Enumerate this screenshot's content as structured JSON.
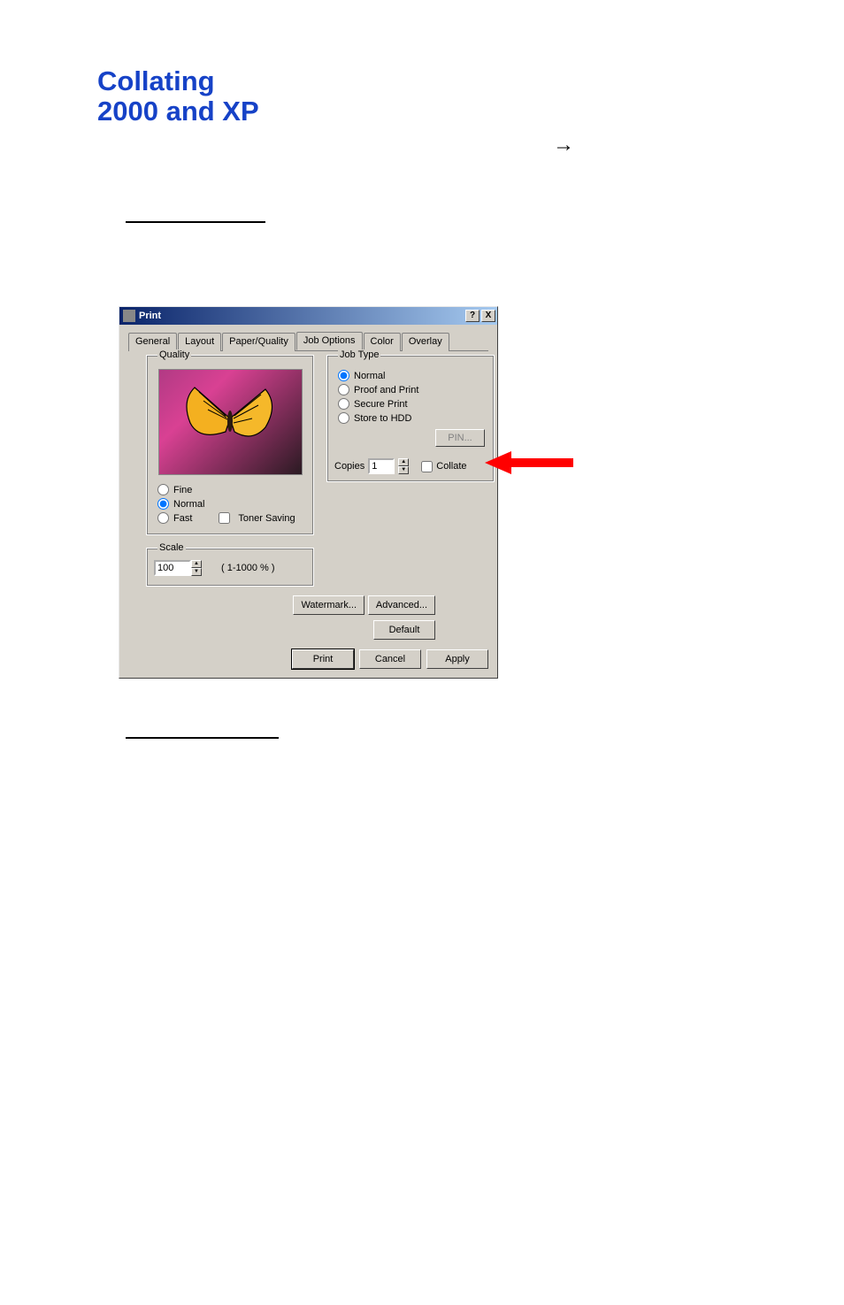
{
  "page": {
    "title_line1": "Collating",
    "title_line2": "2000 and XP"
  },
  "dialog": {
    "title": "Print",
    "help_btn": "?",
    "close_btn": "X",
    "tabs": [
      "General",
      "Layout",
      "Paper/Quality",
      "Job Options",
      "Color",
      "Overlay"
    ],
    "active_tab_index": 3,
    "quality": {
      "legend": "Quality",
      "options": [
        "Fine",
        "Normal",
        "Fast"
      ],
      "selected": "Normal",
      "toner_saving": "Toner Saving",
      "toner_saving_checked": false
    },
    "scale": {
      "legend": "Scale",
      "value": "100",
      "range": "( 1-1000 % )"
    },
    "job_type": {
      "legend": "Job Type",
      "options": [
        "Normal",
        "Proof and Print",
        "Secure Print",
        "Store to HDD"
      ],
      "selected": "Normal",
      "pin_btn": "PIN...",
      "copies_label": "Copies",
      "copies_value": "1",
      "collate_label": "Collate",
      "collate_checked": false
    },
    "buttons": {
      "watermark": "Watermark...",
      "advanced": "Advanced...",
      "default": "Default",
      "print": "Print",
      "cancel": "Cancel",
      "apply": "Apply"
    }
  }
}
